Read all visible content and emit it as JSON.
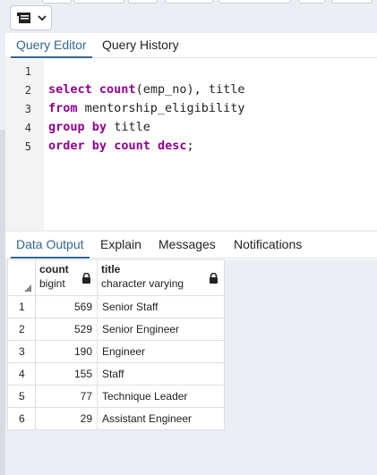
{
  "editor": {
    "tabs": [
      {
        "label": "Query Editor",
        "active": true
      },
      {
        "label": "Query History",
        "active": false
      }
    ],
    "line_numbers": [
      "1",
      "2",
      "3",
      "4",
      "5"
    ],
    "code_lines": [
      "",
      "select count(emp_no), title",
      "from mentorship_eligibility",
      "group by title",
      "order by count desc;"
    ]
  },
  "output": {
    "tabs": [
      {
        "label": "Data Output",
        "active": true
      },
      {
        "label": "Explain",
        "active": false
      },
      {
        "label": "Messages",
        "active": false
      },
      {
        "label": "Notifications",
        "active": false
      }
    ],
    "columns": [
      {
        "name": "count",
        "type": "bigint"
      },
      {
        "name": "title",
        "type": "character varying"
      }
    ],
    "rows": [
      {
        "num": "1",
        "count": "569",
        "title": "Senior Staff"
      },
      {
        "num": "2",
        "count": "529",
        "title": "Senior Engineer"
      },
      {
        "num": "3",
        "count": "190",
        "title": "Engineer"
      },
      {
        "num": "4",
        "count": "155",
        "title": "Staff"
      },
      {
        "num": "5",
        "count": "77",
        "title": "Technique Leader"
      },
      {
        "num": "6",
        "count": "29",
        "title": "Assistant Engineer"
      }
    ]
  },
  "toolbar": {
    "macro_icon": "macro-icon",
    "dropdown_icon": "chevron-down-icon"
  },
  "colors": {
    "accent": "#326690",
    "keyword": "#900090"
  }
}
